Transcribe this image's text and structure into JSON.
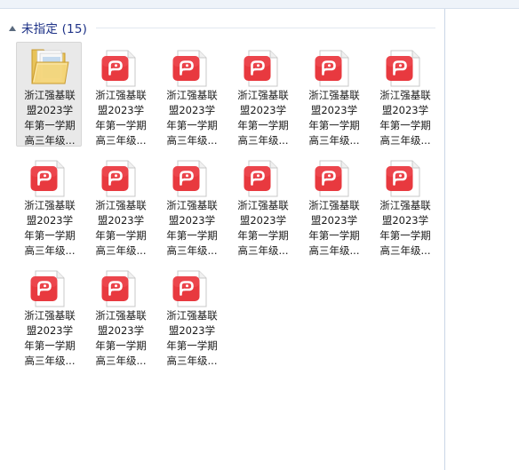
{
  "group": {
    "title": "未指定 (15)",
    "expanded": true
  },
  "accent_color": "#1e3287",
  "files": [
    {
      "type": "folder-icon",
      "lines": [
        "浙江强基联",
        "盟2023学",
        "年第一学期",
        "高三年级..."
      ],
      "selected": true
    },
    {
      "type": "pdf-icon",
      "lines": [
        "浙江强基联",
        "盟2023学",
        "年第一学期",
        "高三年级..."
      ]
    },
    {
      "type": "pdf-icon",
      "lines": [
        "浙江强基联",
        "盟2023学",
        "年第一学期",
        "高三年级..."
      ]
    },
    {
      "type": "pdf-icon",
      "lines": [
        "浙江强基联",
        "盟2023学",
        "年第一学期",
        "高三年级..."
      ]
    },
    {
      "type": "pdf-icon",
      "lines": [
        "浙江强基联",
        "盟2023学",
        "年第一学期",
        "高三年级..."
      ]
    },
    {
      "type": "pdf-icon",
      "lines": [
        "浙江强基联",
        "盟2023学",
        "年第一学期",
        "高三年级..."
      ]
    },
    {
      "type": "pdf-icon",
      "lines": [
        "浙江强基联",
        "盟2023学",
        "年第一学期",
        "高三年级..."
      ]
    },
    {
      "type": "pdf-icon",
      "lines": [
        "浙江强基联",
        "盟2023学",
        "年第一学期",
        "高三年级..."
      ]
    },
    {
      "type": "pdf-icon",
      "lines": [
        "浙江强基联",
        "盟2023学",
        "年第一学期",
        "高三年级..."
      ]
    },
    {
      "type": "pdf-icon",
      "lines": [
        "浙江强基联",
        "盟2023学",
        "年第一学期",
        "高三年级..."
      ]
    },
    {
      "type": "pdf-icon",
      "lines": [
        "浙江强基联",
        "盟2023学",
        "年第一学期",
        "高三年级..."
      ]
    },
    {
      "type": "pdf-icon",
      "lines": [
        "浙江强基联",
        "盟2023学",
        "年第一学期",
        "高三年级..."
      ]
    },
    {
      "type": "pdf-icon",
      "lines": [
        "浙江强基联",
        "盟2023学",
        "年第一学期",
        "高三年级..."
      ]
    },
    {
      "type": "pdf-icon",
      "lines": [
        "浙江强基联",
        "盟2023学",
        "年第一学期",
        "高三年级..."
      ]
    },
    {
      "type": "pdf-icon",
      "lines": [
        "浙江强基联",
        "盟2023学",
        "年第一学期",
        "高三年级..."
      ]
    }
  ]
}
